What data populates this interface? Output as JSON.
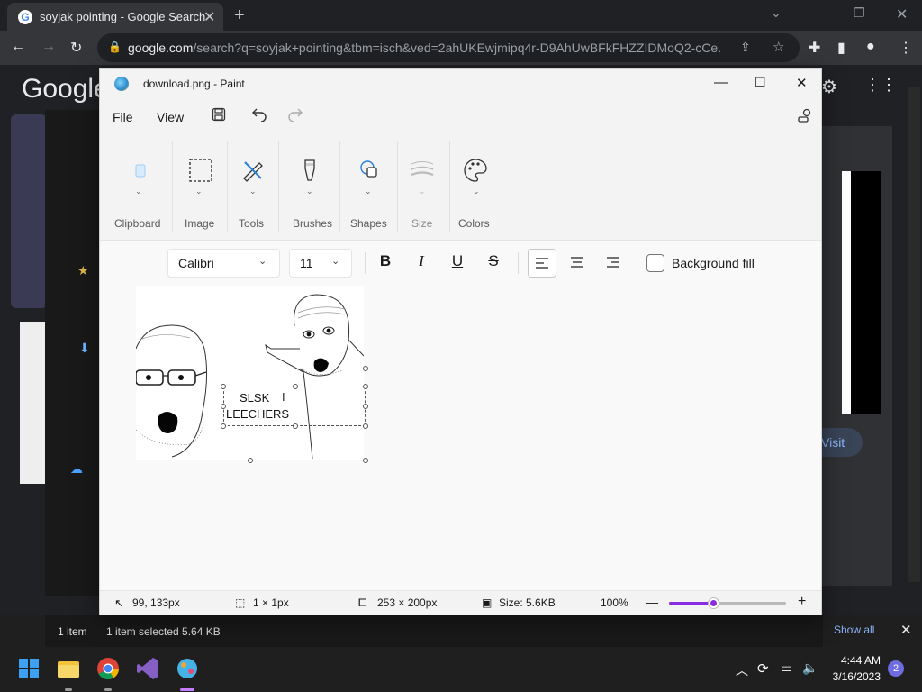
{
  "browser": {
    "tab_title": "soyjak pointing - Google Search",
    "url_domain": "google.com",
    "url_path": "/search?q=soyjak+pointing&tbm=isch&ved=2ahUKEwjmipq4r-D9AhUwBFkFHZZIDMoQ2-cCe...",
    "google_logo": "Google",
    "visit_label": "Visit"
  },
  "explorer": {
    "item_count": "1 item",
    "selected": "1 item selected  5.64 KB",
    "show_all": "Show all"
  },
  "paint": {
    "window_title": "download.png - Paint",
    "menu": {
      "file": "File",
      "view": "View"
    },
    "ribbon": {
      "clipboard": "Clipboard",
      "image": "Image",
      "tools": "Tools",
      "brushes": "Brushes",
      "shapes": "Shapes",
      "size": "Size",
      "colors": "Colors"
    },
    "text_toolbar": {
      "font": "Calibri",
      "font_size": "11",
      "background_fill": "Background fill",
      "bold_glyph": "B",
      "italic_glyph": "I",
      "underline_glyph": "U",
      "strike_glyph": "S"
    },
    "textbox": {
      "line1": "SLSK",
      "line2": "LEECHERS"
    },
    "status": {
      "cursor_pos": "99, 133px",
      "selection_size": "1 × 1px",
      "canvas_size": "253 × 200px",
      "file_size": "Size: 5.6KB",
      "zoom": "100%",
      "zoom_fraction": 0.38
    }
  },
  "taskbar": {
    "time": "4:44 AM",
    "date": "3/16/2023",
    "notifications": "2"
  },
  "colors": {
    "accent": "#8a2be2",
    "chrome_bg": "#202124"
  }
}
